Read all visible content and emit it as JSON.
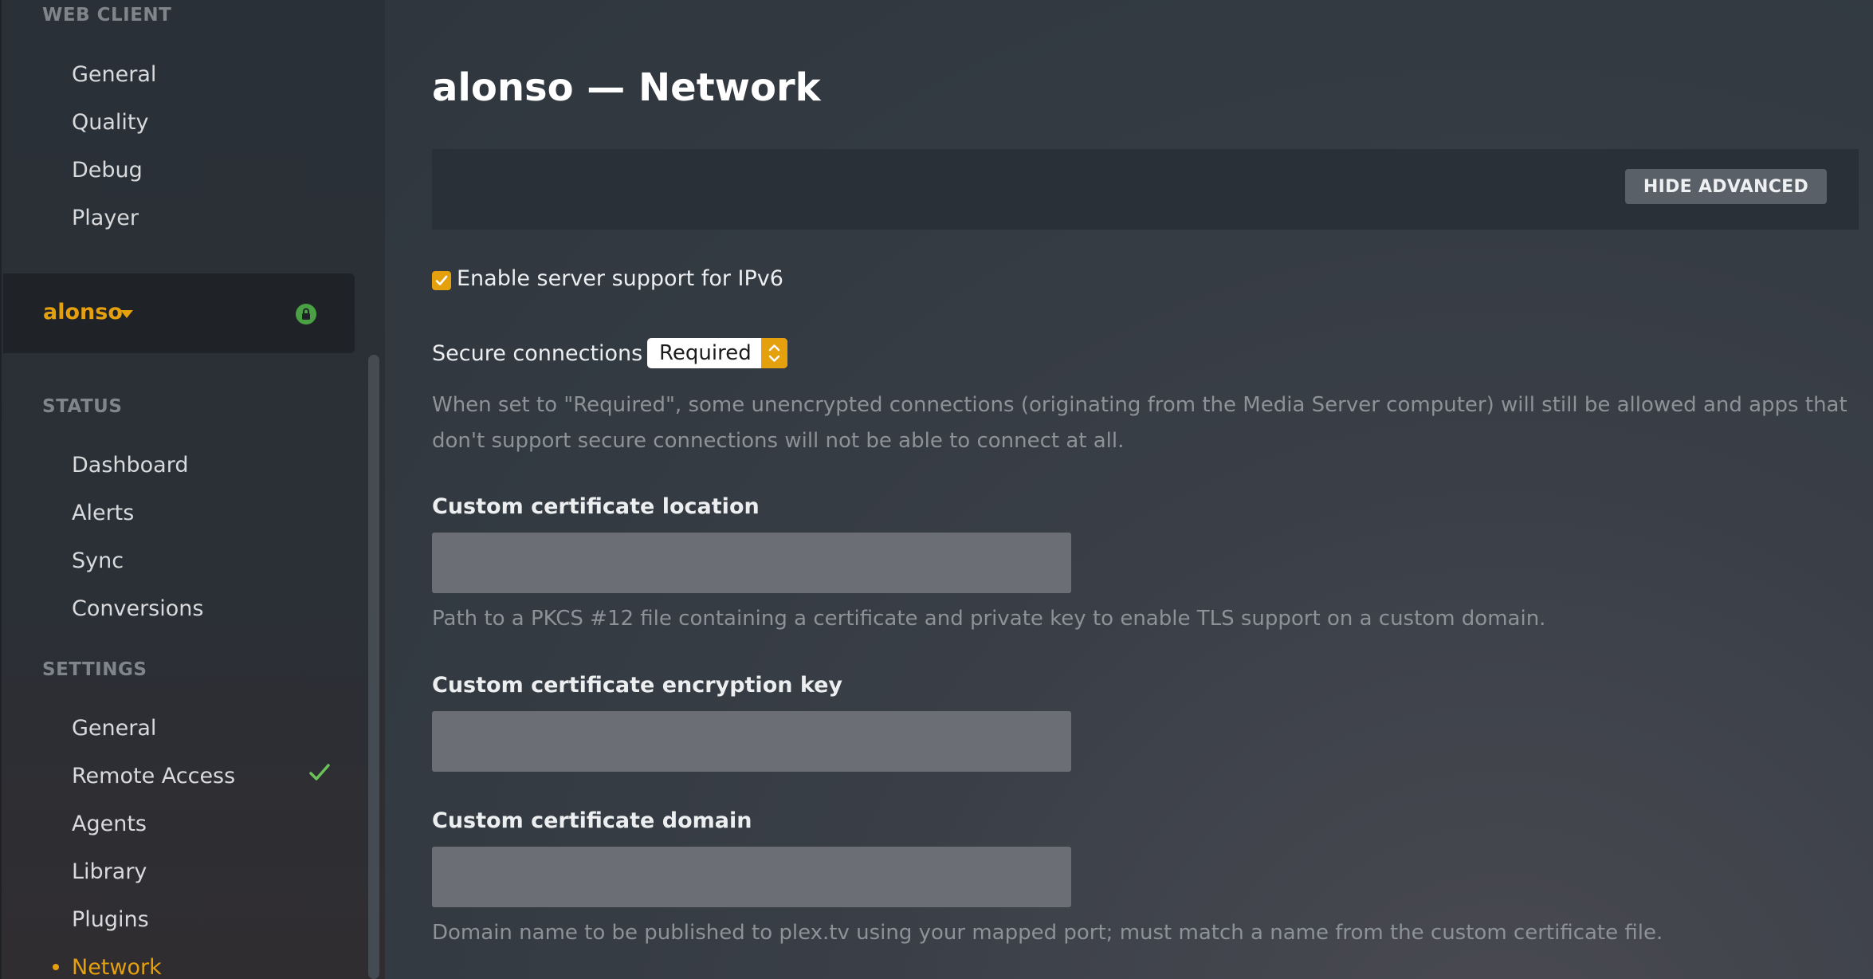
{
  "sidebar": {
    "web_client_heading": "WEB CLIENT",
    "web_client_items": [
      {
        "label": "General"
      },
      {
        "label": "Quality"
      },
      {
        "label": "Debug"
      },
      {
        "label": "Player"
      }
    ],
    "server": {
      "name": "alonso",
      "caret_icon": "caret-down-icon",
      "lock_icon": "lock-icon",
      "lock_color": "#49a144"
    },
    "status_heading": "STATUS",
    "status_items": [
      {
        "label": "Dashboard"
      },
      {
        "label": "Alerts"
      },
      {
        "label": "Sync"
      },
      {
        "label": "Conversions"
      }
    ],
    "settings_heading": "SETTINGS",
    "settings_items": [
      {
        "label": "General"
      },
      {
        "label": "Remote Access",
        "status_icon": "checkmark-icon",
        "status_color": "#6ac259"
      },
      {
        "label": "Agents"
      },
      {
        "label": "Library"
      },
      {
        "label": "Plugins"
      },
      {
        "label": "Network",
        "active": true
      }
    ],
    "accent_color": "#e5a00d"
  },
  "main": {
    "title": "alonso — Network",
    "advanced_button": "HIDE ADVANCED",
    "ipv6": {
      "label": "Enable server support for IPv6",
      "checked": true
    },
    "secure_connections": {
      "label": "Secure connections",
      "value": "Required",
      "help": "When set to \"Required\", some unencrypted connections (originating from the Media Server computer) will still be allowed and apps that don't support secure connections will not be able to connect at all."
    },
    "cert_location": {
      "label": "Custom certificate location",
      "value": "",
      "help": "Path to a PKCS #12 file containing a certificate and private key to enable TLS support on a custom domain."
    },
    "cert_key": {
      "label": "Custom certificate encryption key",
      "value": ""
    },
    "cert_domain": {
      "label": "Custom certificate domain",
      "value": "",
      "help": "Domain name to be published to plex.tv using your mapped port; must match a name from the custom certificate file."
    }
  }
}
